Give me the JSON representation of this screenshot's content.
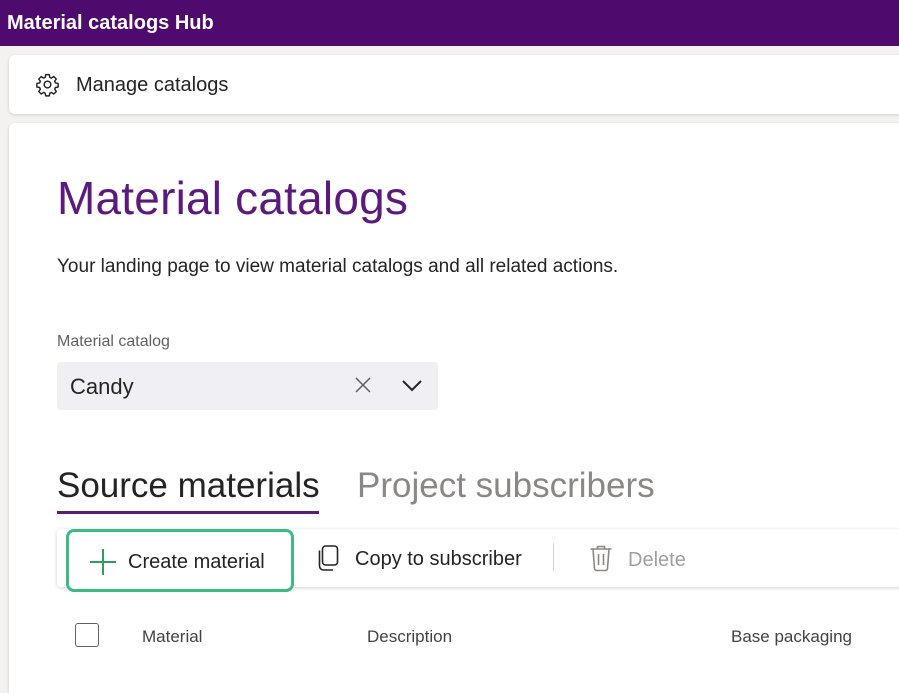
{
  "app": {
    "title": "Material catalogs Hub"
  },
  "command_bar": {
    "icon": "gear-icon",
    "label": "Manage catalogs"
  },
  "page": {
    "title": "Material catalogs",
    "subtitle": "Your landing page to view material catalogs and all related actions."
  },
  "catalog_field": {
    "label": "Material catalog",
    "value": "Candy",
    "clear_icon": "close-icon",
    "expand_icon": "chevron-down-icon"
  },
  "tabs": [
    {
      "label": "Source materials",
      "selected": true
    },
    {
      "label": "Project subscribers",
      "selected": false
    }
  ],
  "toolbar": {
    "create": {
      "label": "Create material",
      "icon": "plus-icon"
    },
    "copy": {
      "label": "Copy to subscriber",
      "icon": "copy-icon"
    },
    "delete": {
      "label": "Delete",
      "icon": "trash-icon",
      "disabled": true
    }
  },
  "table": {
    "columns": [
      "Material",
      "Description",
      "Base packaging"
    ]
  },
  "colors": {
    "titlebar": "#4f0a6e",
    "accent": "#5c1a7e",
    "focus_ring": "#3dbb82",
    "plus_icon": "#2aa05b"
  }
}
